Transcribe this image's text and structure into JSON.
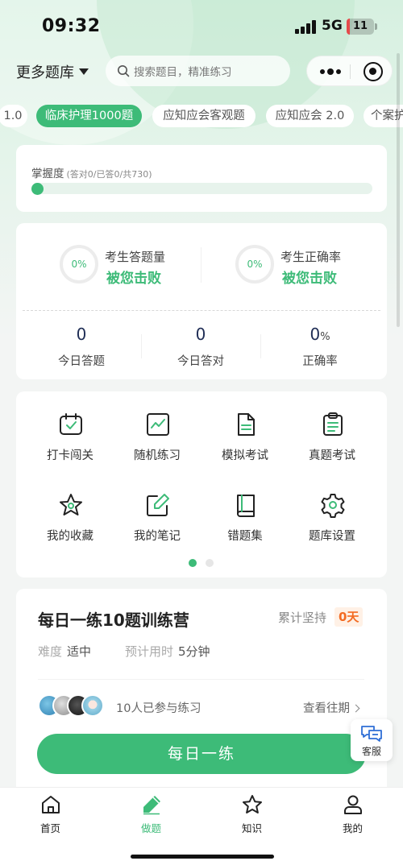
{
  "status_bar": {
    "time": "09:32",
    "network": "5G",
    "battery": "11",
    "battery_level": 0.11
  },
  "nav": {
    "bank_switch": "更多题库",
    "search_placeholder": "搜索题目，精准练习"
  },
  "tabs": [
    {
      "label": "1.0",
      "active": false
    },
    {
      "label": "临床护理1000题",
      "active": true
    },
    {
      "label": "应知应会客观题",
      "active": false
    },
    {
      "label": "应知应会 2.0",
      "active": false
    },
    {
      "label": "个案护",
      "active": false
    }
  ],
  "mastery": {
    "title": "掌握度",
    "detail": "(答对0/已答0/共730)",
    "progress": 0
  },
  "stats": {
    "answer_volume": {
      "percent": "0%",
      "label": "考生答题量",
      "value": "被您击败"
    },
    "accuracy": {
      "percent": "0%",
      "label": "考生正确率",
      "value": "被您击败"
    },
    "today_answered": {
      "value": "0",
      "label": "今日答题"
    },
    "today_correct": {
      "value": "0",
      "label": "今日答对"
    },
    "correct_rate": {
      "value": "0",
      "unit": "%",
      "label": "正确率"
    }
  },
  "grid": {
    "items": [
      {
        "label": "打卡闯关",
        "icon": "calendar-check-icon"
      },
      {
        "label": "随机练习",
        "icon": "trend-chart-icon"
      },
      {
        "label": "模拟考试",
        "icon": "document-icon"
      },
      {
        "label": "真题考试",
        "icon": "clipboard-icon"
      },
      {
        "label": "我的收藏",
        "icon": "star-icon"
      },
      {
        "label": "我的笔记",
        "icon": "edit-note-icon"
      },
      {
        "label": "错题集",
        "icon": "book-icon"
      },
      {
        "label": "题库设置",
        "icon": "gear-icon"
      }
    ],
    "page": 1,
    "page_count": 2
  },
  "daily": {
    "title": "每日一练10题训练营",
    "streak_label": "累计坚持",
    "streak_days": "0天",
    "difficulty_label": "难度",
    "difficulty_value": "适中",
    "time_label": "预计用时",
    "time_value": "5分钟",
    "participants": "10人已参与练习",
    "history_link": "查看往期",
    "cta": "每日一练"
  },
  "service": {
    "label": "客服"
  },
  "tabbar": [
    {
      "label": "首页",
      "icon": "home-icon",
      "active": false
    },
    {
      "label": "做题",
      "icon": "pencil-icon",
      "active": true
    },
    {
      "label": "知识",
      "icon": "star-icon",
      "active": false
    },
    {
      "label": "我的",
      "icon": "user-icon",
      "active": false
    }
  ],
  "colors": {
    "primary": "#3dbb78",
    "primary_light": "#e7f3ec",
    "accent_orange": "#f36b22",
    "number_navy": "#1f2d55",
    "battery_low": "#e54b4b"
  }
}
